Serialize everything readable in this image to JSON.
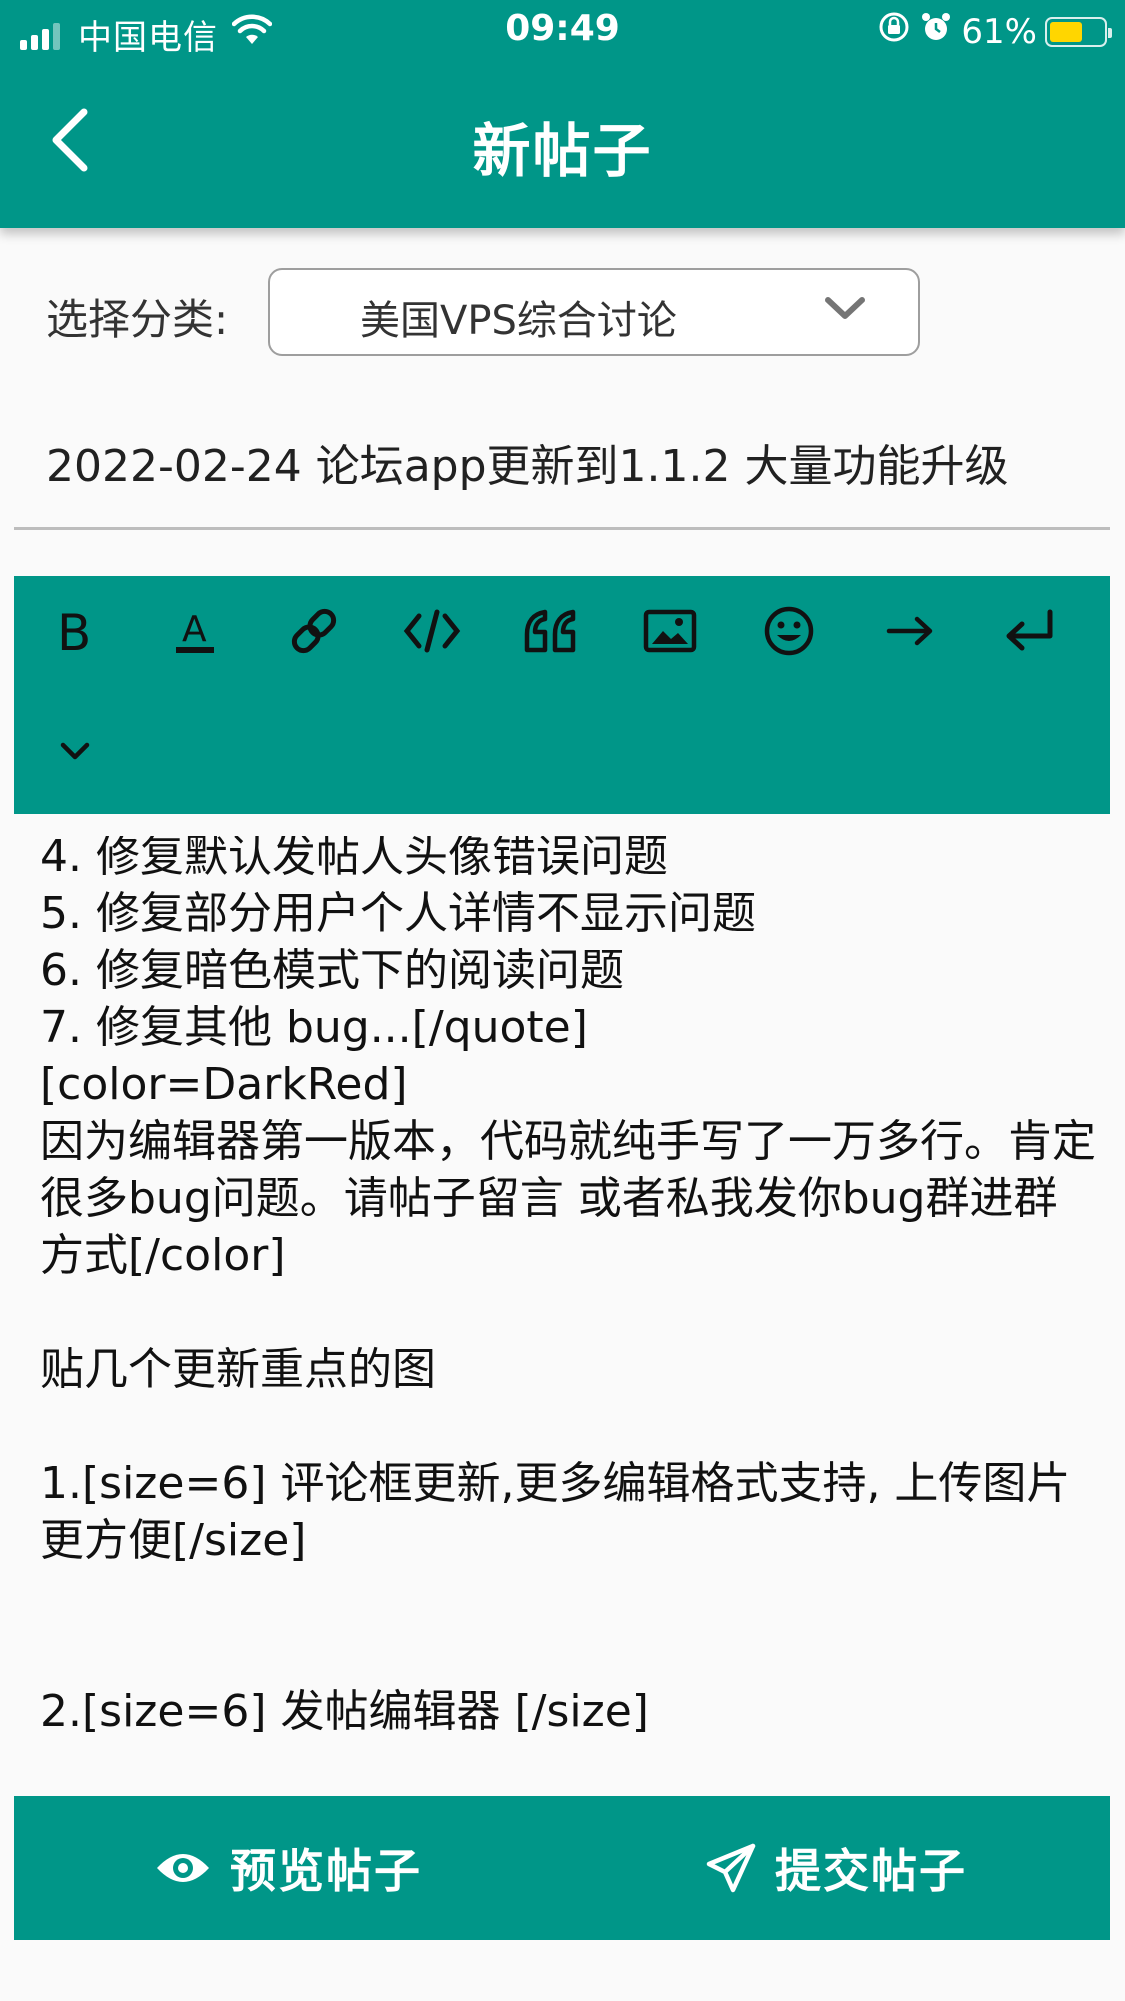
{
  "status_bar": {
    "carrier": "中国电信",
    "time": "09:49",
    "battery": "61%",
    "battery_level": 0.61
  },
  "app_bar": {
    "title": "新帖子",
    "back_icon": "chevron-left-icon"
  },
  "category": {
    "label": "选择分类:",
    "selected": "美国VPS综合讨论"
  },
  "post_title": "2022-02-24 论坛app更新到1.1.2 大量功能升级",
  "toolbar": {
    "tools": [
      {
        "name": "bold-icon"
      },
      {
        "name": "text-color-icon"
      },
      {
        "name": "link-icon"
      },
      {
        "name": "code-icon"
      },
      {
        "name": "quote-icon"
      },
      {
        "name": "image-icon"
      },
      {
        "name": "emoji-icon"
      },
      {
        "name": "indent-icon"
      },
      {
        "name": "return-icon"
      },
      {
        "name": "collapse-icon"
      }
    ]
  },
  "editor": {
    "content": "4. 修复默认发帖人头像错误问题\n5. 修复部分用户个人详情不显示问题\n6. 修复暗色模式下的阅读问题\n7. 修复其他 bug...[/quote]\n[color=DarkRed]\n因为编辑器第一版本，代码就纯手写了一万多行。肯定很多bug问题。请帖子留言 或者私我发你bug群进群方式[/color]\n\n贴几个更新重点的图\n\n1.[size=6] 评论框更新,更多编辑格式支持, 上传图片更方便[/size]\n\n\n2.[size=6] 发帖编辑器 [/size]"
  },
  "actions": {
    "preview_label": "预览帖子",
    "submit_label": "提交帖子"
  },
  "colors": {
    "primary": "#009688",
    "battery": "#ffd600"
  }
}
